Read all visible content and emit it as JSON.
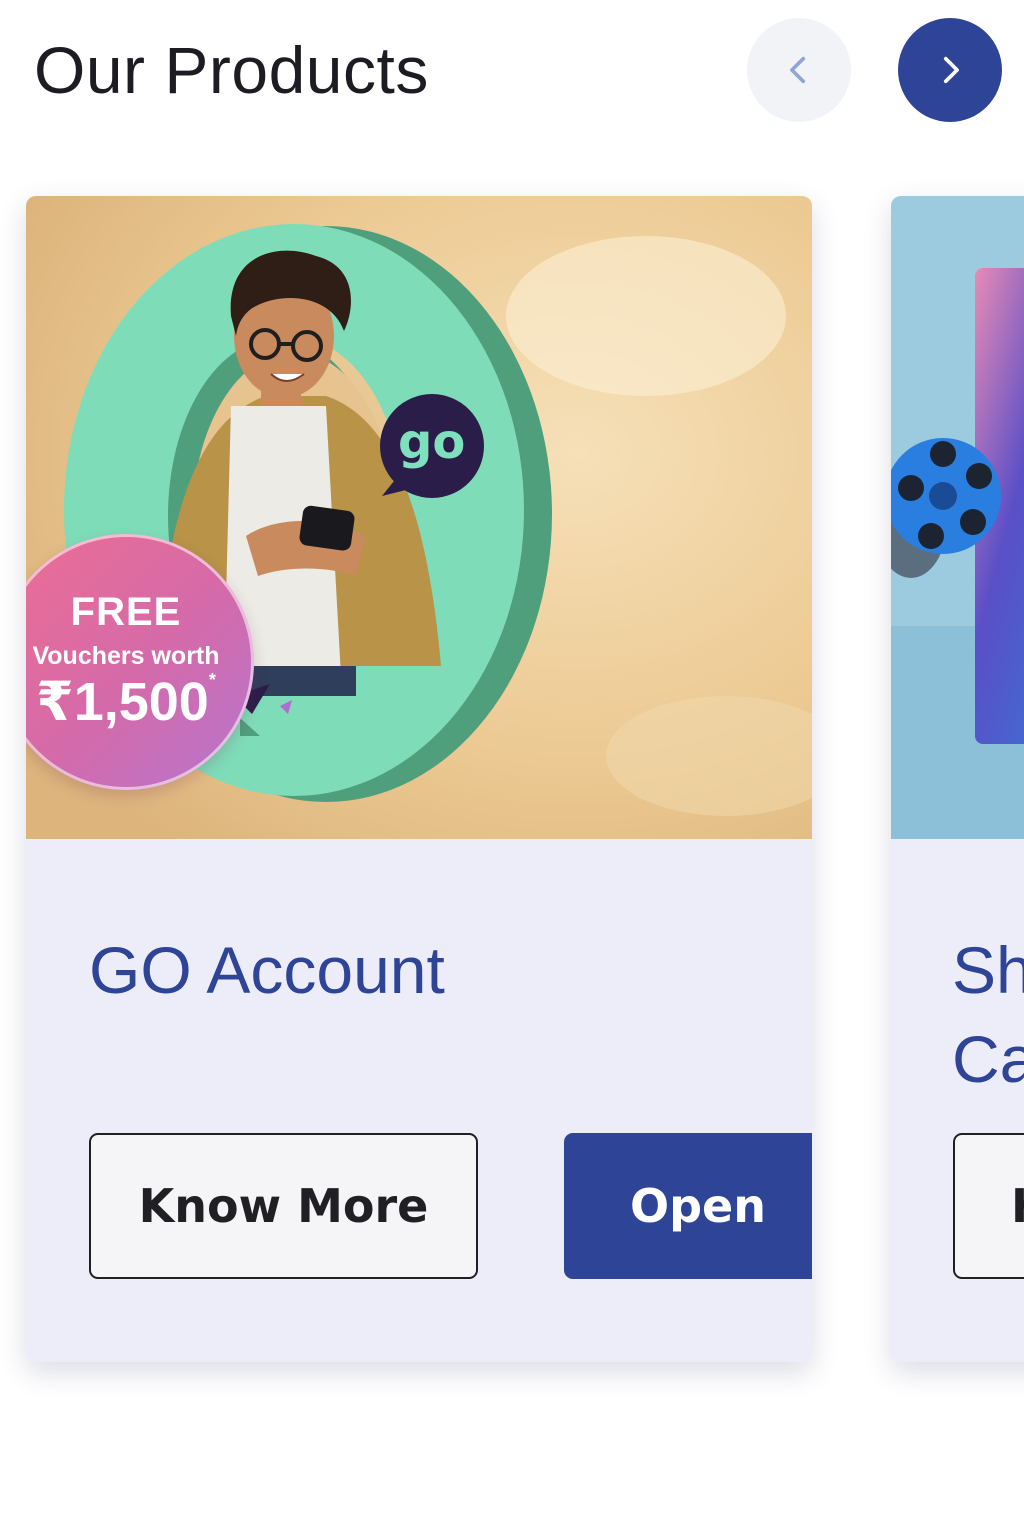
{
  "header": {
    "title": "Our Products",
    "prev_icon": "chevron-left-icon",
    "next_icon": "chevron-right-icon"
  },
  "products": [
    {
      "title": "GO Account",
      "promo": {
        "line1": "FREE",
        "line2": "Vouchers worth",
        "amount": "₹1,500",
        "asterisk": "*"
      },
      "logo_text": "go",
      "buttons": {
        "secondary": "Know More",
        "primary": "Open"
      }
    },
    {
      "title": "Sh\nCa",
      "buttons": {
        "secondary": "K"
      }
    }
  ],
  "colors": {
    "brand_blue": "#2e4496",
    "card_background": "#ecedf9",
    "badge_pink": "#ee6e92",
    "badge_purple": "#b576cf",
    "mint": "#7ee0bd"
  }
}
